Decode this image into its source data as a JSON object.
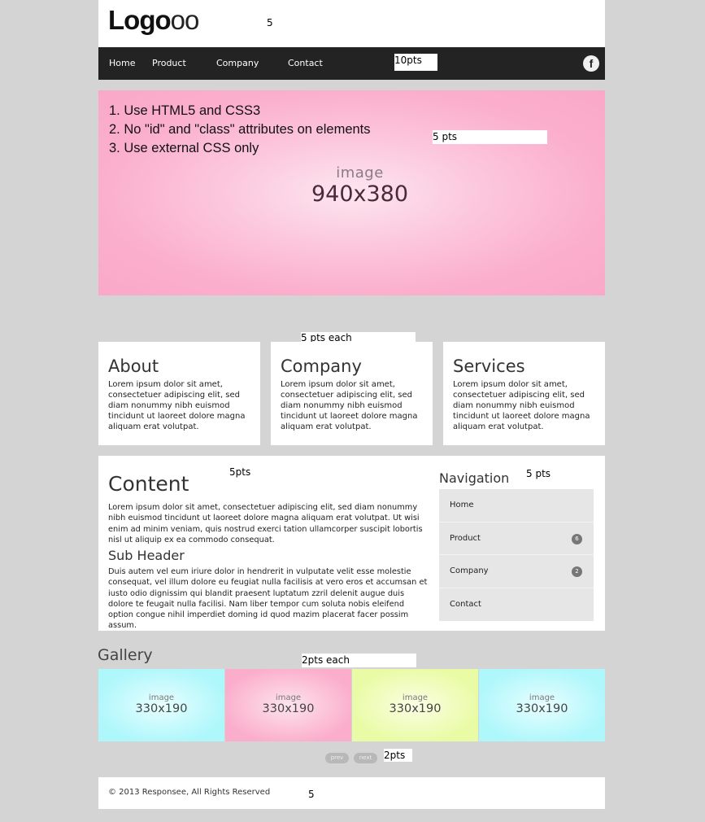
{
  "header": {
    "logo_bold": "Logo",
    "logo_light": "oo",
    "note": "5"
  },
  "nav": {
    "items": [
      "Home",
      "Product",
      "Company",
      "Contact"
    ],
    "note": "10pts",
    "social_icon": "facebook-icon",
    "social_glyph": "f"
  },
  "hero": {
    "rules": [
      "1. Use HTML5 and CSS3",
      "2. No \"id\" and \"class\" attributes on elements",
      "3. Use external CSS only"
    ],
    "image_word": "image",
    "image_size": "940x380",
    "note": "5 pts"
  },
  "boxes": {
    "note": "5 pts each",
    "items": [
      {
        "title": "About",
        "text": "Lorem ipsum dolor sit amet, consectetuer adipiscing elit, sed diam nonummy nibh euismod tincidunt ut laoreet dolore magna aliquam erat volutpat."
      },
      {
        "title": "Company",
        "text": "Lorem ipsum dolor sit amet, consectetuer adipiscing elit, sed diam nonummy nibh euismod tincidunt ut laoreet dolore magna aliquam erat volutpat."
      },
      {
        "title": "Services",
        "text": "Lorem ipsum dolor sit amet, consectetuer adipiscing elit, sed diam nonummy nibh euismod tincidunt ut laoreet dolore magna aliquam erat volutpat."
      }
    ]
  },
  "content": {
    "title": "Content",
    "note": "5pts",
    "para1": "Lorem ipsum dolor sit amet, consectetuer adipiscing elit, sed diam nonummy nibh euismod tincidunt ut laoreet dolore magna aliquam erat volutpat. Ut wisi enim ad minim veniam, quis nostrud exerci tation ullamcorper suscipit lobortis nisl ut aliquip ex ea commodo consequat.",
    "subheader": "Sub Header",
    "para2": "Duis autem vel eum iriure dolor in hendrerit in vulputate velit esse molestie consequat, vel illum dolore eu feugiat nulla facilisis at vero eros et accumsan et iusto odio dignissim qui blandit praesent luptatum zzril delenit augue duis dolore te feugait nulla facilisi. Nam liber tempor cum soluta nobis eleifend option congue nihil imperdiet doming id quod mazim placerat facer possim assum."
  },
  "sidebar": {
    "title": "Navigation",
    "note": "5 pts",
    "items": [
      {
        "label": "Home",
        "badge": ""
      },
      {
        "label": "Product",
        "badge": "6"
      },
      {
        "label": "Company",
        "badge": "2"
      },
      {
        "label": "Contact",
        "badge": ""
      }
    ]
  },
  "gallery": {
    "title": "Gallery",
    "note": "2pts each",
    "tiles": [
      {
        "word": "image",
        "size": "330x190",
        "color": "#aef7fb"
      },
      {
        "word": "image",
        "size": "330x190",
        "color": "#fbaecb"
      },
      {
        "word": "image",
        "size": "330x190",
        "color": "#e9fba4"
      },
      {
        "word": "image",
        "size": "330x190",
        "color": "#aef7fb"
      }
    ],
    "prev_label": "prev",
    "next_label": "next",
    "pager_note": "2pts"
  },
  "footer": {
    "copyright": "© 2013 Responsee, All Rights Reserved",
    "note": "5"
  }
}
